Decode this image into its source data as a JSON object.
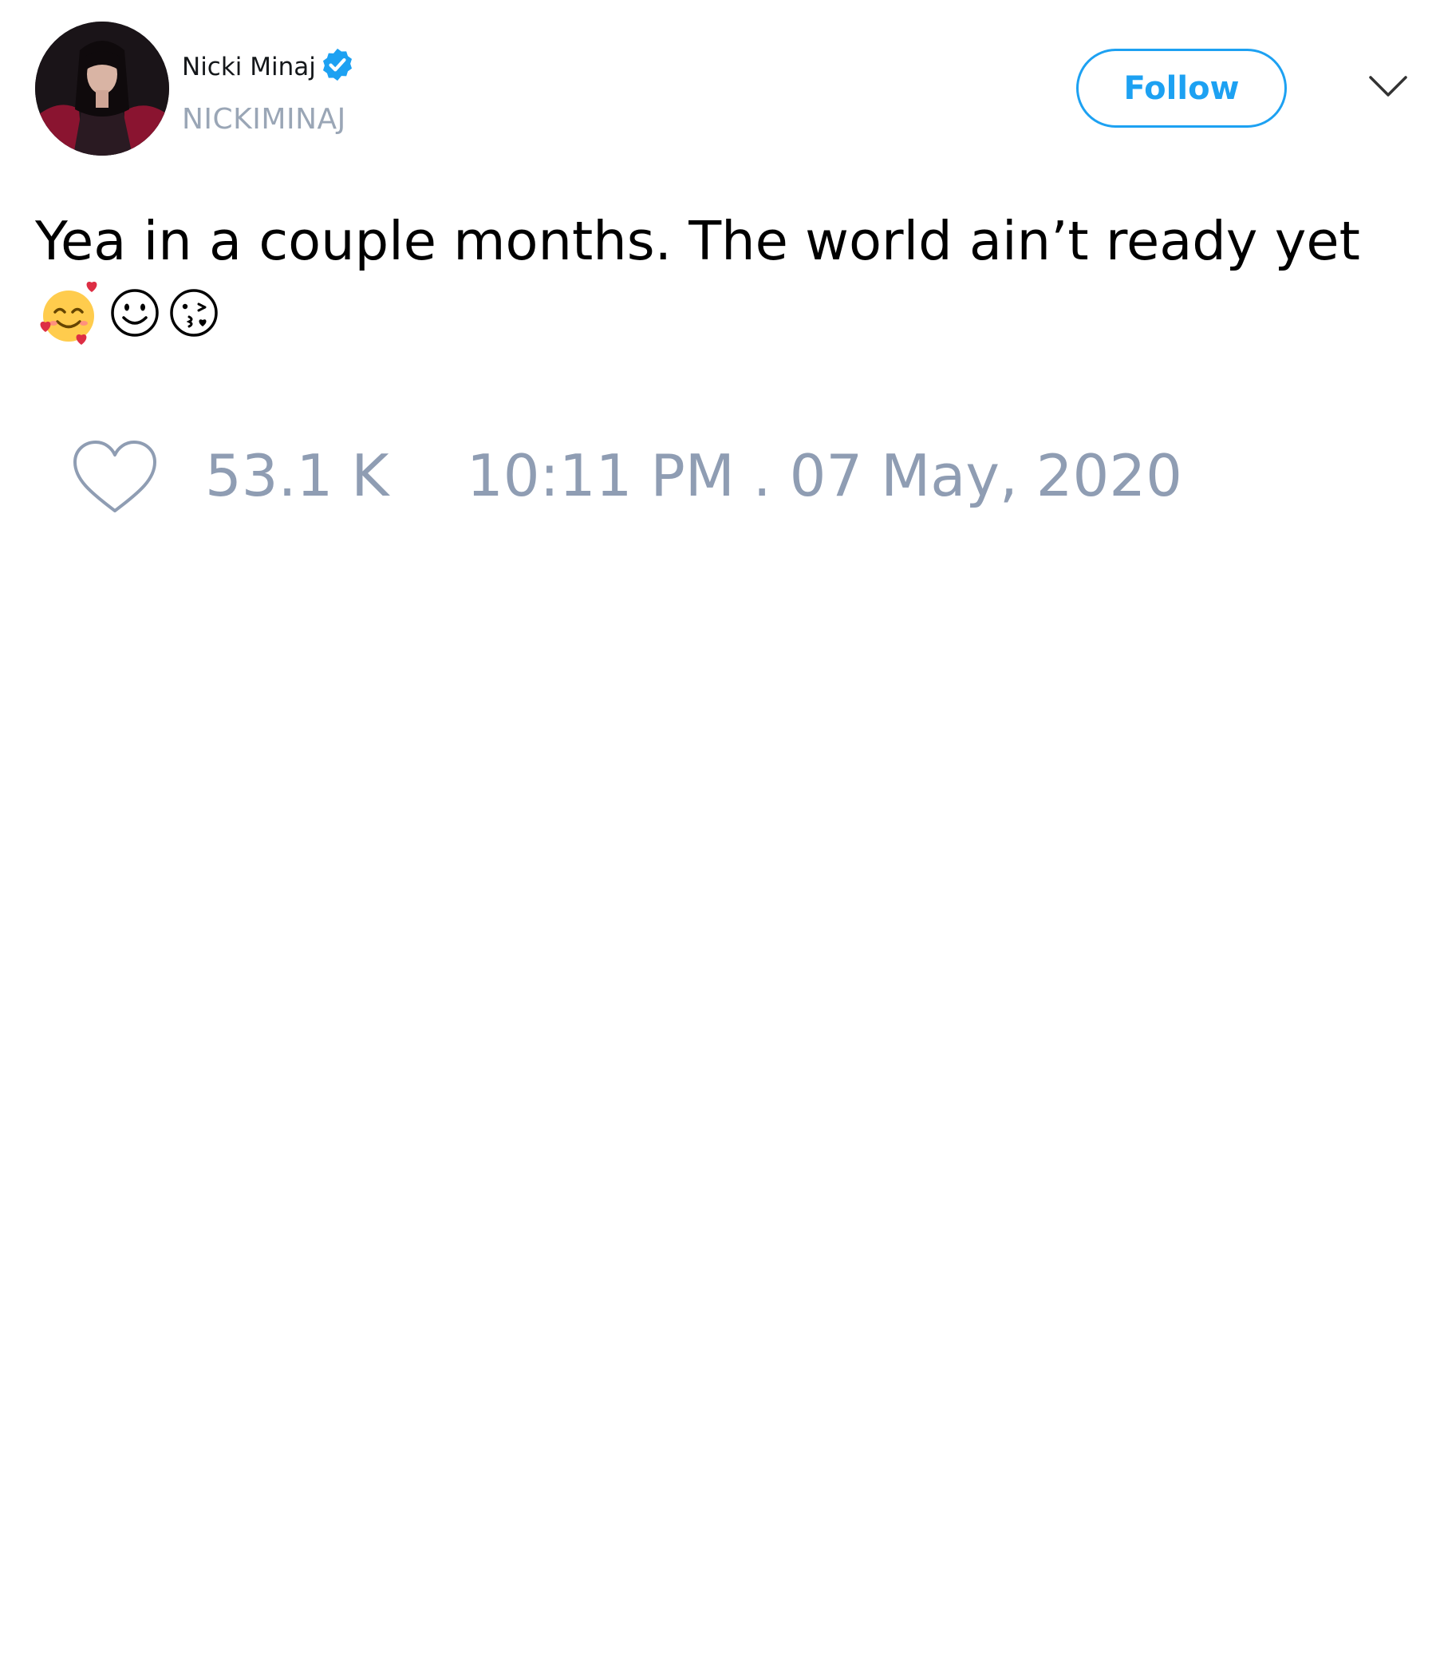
{
  "tweet": {
    "author": {
      "display_name": "Nicki Minaj",
      "handle": "NICKIMINAJ",
      "verified": true
    },
    "follow_label": "Follow",
    "text": "Yea in a couple months. The world ain’t ready yet",
    "emojis": [
      "smiling-face-with-hearts-icon",
      "smiling-face-icon",
      "face-blowing-kiss-icon"
    ],
    "likes": "53.1 K",
    "timestamp": "10:11 PM . 07 May, 2020"
  },
  "colors": {
    "accent": "#1da1f2",
    "muted": "#8f9db3",
    "text": "#000000"
  }
}
